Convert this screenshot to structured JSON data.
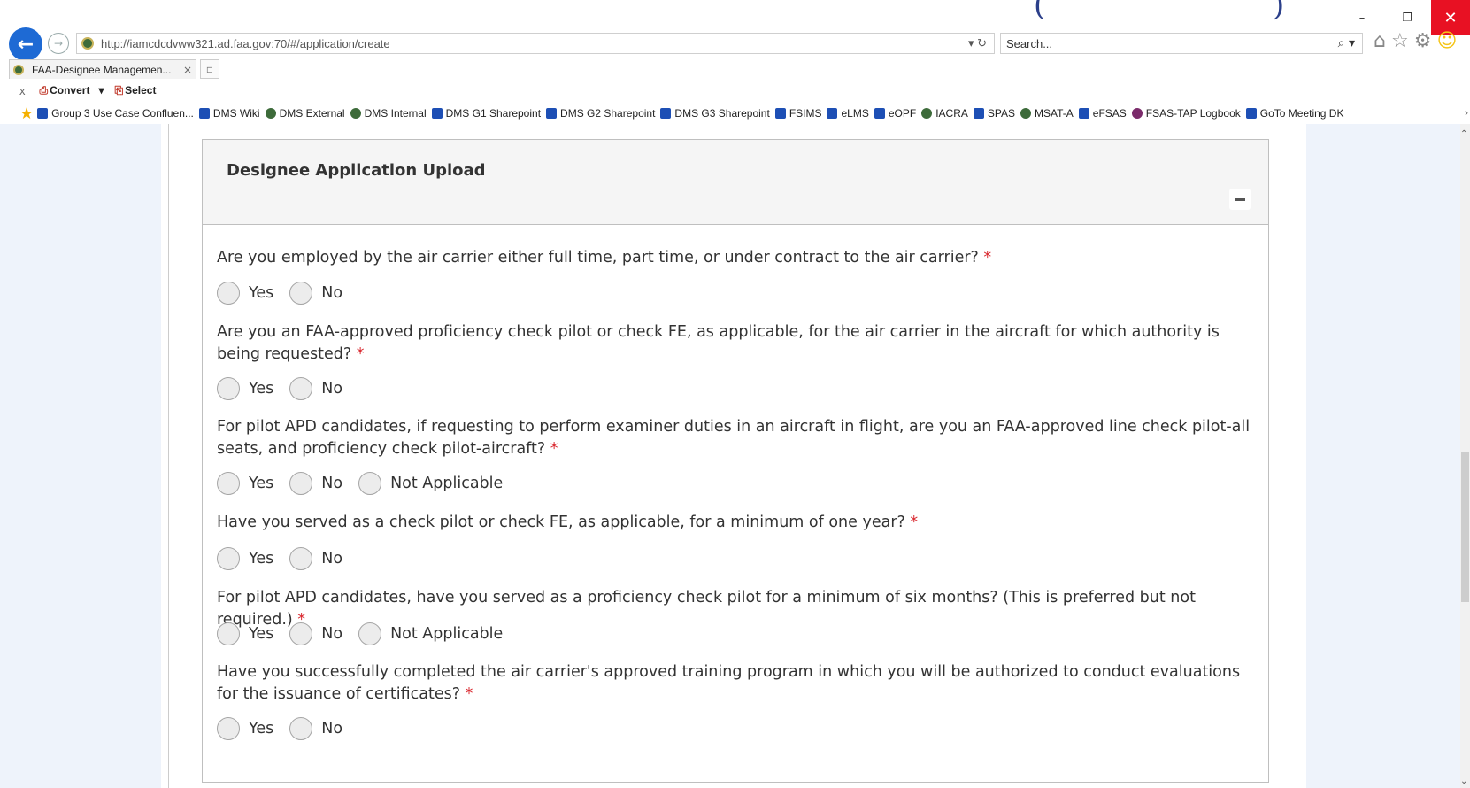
{
  "browser": {
    "title_glyph_left": "(",
    "title_glyph_right": ")",
    "window_controls": {
      "minimize": "–",
      "restore": "❐",
      "close": "✕"
    },
    "url": "http://iamcdcdvww321.ad.faa.gov:70/#/application/create",
    "addr_tools": "▾ ↻",
    "search_placeholder": "Search...",
    "tab_label": "FAA-Designee Managemen...",
    "tab_close": "×",
    "cmd": {
      "close": "x",
      "convert": "Convert",
      "select": "Select"
    },
    "favorites": [
      "Group 3 Use Case Confluen...",
      "DMS Wiki",
      "DMS External",
      "DMS Internal",
      "DMS G1 Sharepoint",
      "DMS G2 Sharepoint",
      "DMS G3 Sharepoint",
      "FSIMS",
      "eLMS",
      "eOPF",
      "IACRA",
      "SPAS",
      "MSAT-A",
      "eFSAS",
      "FSAS-TAP Logbook",
      "GoTo Meeting DK"
    ]
  },
  "panel": {
    "title": "Designee Application Upload",
    "required_mark": "*"
  },
  "questions": [
    {
      "text": "Are you employed by the air carrier either full time, part time, or under contract to the air carrier?",
      "options": [
        "Yes",
        "No"
      ]
    },
    {
      "text": "Are you an FAA-approved proficiency check pilot or check FE, as applicable, for the air carrier in the aircraft for which authority is being requested?",
      "options": [
        "Yes",
        "No"
      ]
    },
    {
      "text": "For pilot APD candidates, if requesting to perform examiner duties in an aircraft in flight, are you an FAA-approved line check pilot-all seats, and proficiency check pilot-aircraft?",
      "options": [
        "Yes",
        "No",
        "Not Applicable"
      ]
    },
    {
      "text": "Have you served as a check pilot or check FE, as applicable, for a minimum of one year?",
      "options": [
        "Yes",
        "No"
      ]
    },
    {
      "text": "For pilot APD candidates, have you served as a proficiency check pilot for a minimum of six months? (This is preferred but not required.)",
      "options": [
        "Yes",
        "No",
        "Not Applicable"
      ]
    },
    {
      "text": "Have you successfully completed the air carrier's approved training program in which you will be authorized to conduct evaluations for the issuance of certificates?",
      "options": [
        "Yes",
        "No"
      ]
    }
  ],
  "colors": {
    "accent": "#1e6ad4",
    "required": "#d9272e",
    "sidebar": "#eef3fb",
    "close": "#e81123"
  }
}
